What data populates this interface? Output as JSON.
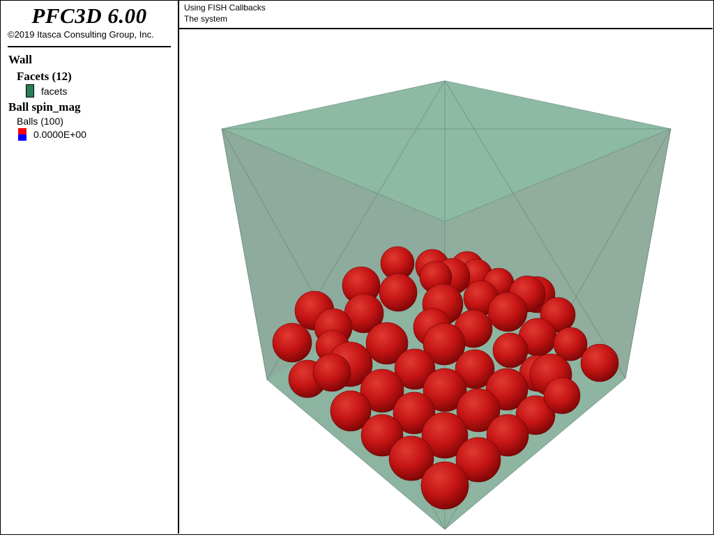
{
  "app": {
    "product_title": "PFC3D 6.00",
    "copyright": "©2019 Itasca Consulting Group, Inc."
  },
  "header": {
    "line1": "Using FISH Callbacks",
    "line2": "The system"
  },
  "legend": {
    "wall_heading": "Wall",
    "facets_heading": "Facets (12)",
    "facets_label": "facets",
    "ball_heading": "Ball spin_mag",
    "balls_label": "Balls (100)",
    "ball_value": "0.0000E+00"
  },
  "colors": {
    "wall_fill": "#89b8a2",
    "facet_swatch": "#2e7d55",
    "ball": "#cc1111",
    "spin_high": "#ff0000",
    "spin_low": "#0000ff"
  }
}
